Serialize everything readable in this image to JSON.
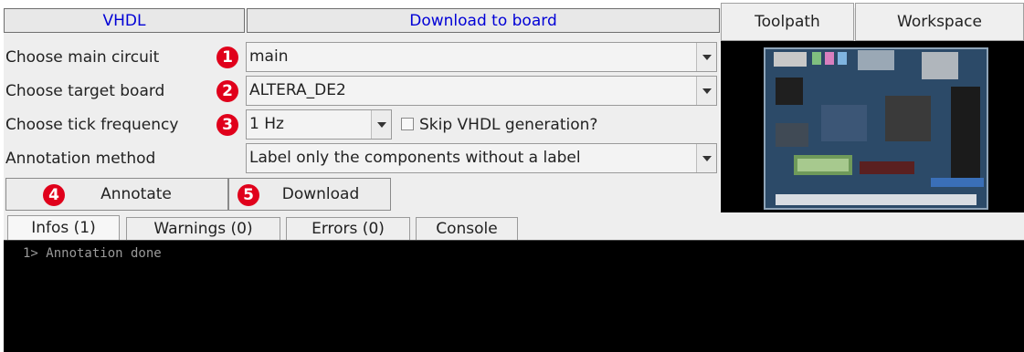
{
  "top_buttons": {
    "vhdl": "VHDL",
    "download_to_board": "Download to board",
    "toolpath": "Toolpath",
    "workspace": "Workspace"
  },
  "rows": [
    {
      "label": "Choose main circuit",
      "value": "main",
      "badge": "1"
    },
    {
      "label": "Choose target board",
      "value": "ALTERA_DE2",
      "badge": "2"
    },
    {
      "label": "Choose tick frequency",
      "value": "1 Hz",
      "badge": "3"
    },
    {
      "label": "Annotation method",
      "value": "Label only the components without a label"
    }
  ],
  "skip_vhdl": {
    "label": "Skip VHDL generation?",
    "checked": false
  },
  "actions": {
    "annotate": {
      "label": "Annotate",
      "badge": "4"
    },
    "download": {
      "label": "Download",
      "badge": "5"
    }
  },
  "tabs": [
    "Infos (1)",
    "Warnings (0)",
    "Errors (0)",
    "Console"
  ],
  "console_lines": [
    "1> Annotation done"
  ],
  "colors": {
    "badge_red": "#e0001b",
    "link_blue": "#0000d6",
    "panel_gray": "#eeeeee"
  },
  "board_image": {
    "icon": "fpga-board-photo"
  }
}
